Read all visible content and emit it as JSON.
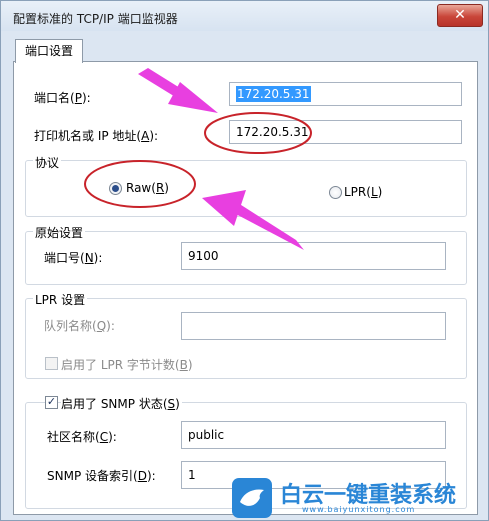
{
  "window": {
    "title": "配置标准的 TCP/IP 端口监视器",
    "close_glyph": "✕"
  },
  "tab": {
    "label": "端口设置"
  },
  "port_name": {
    "label": "端口名(",
    "hotkey": "P",
    "suffix": "):",
    "value": "172.20.5.31"
  },
  "printer_addr": {
    "label": "打印机名或 IP 地址(",
    "hotkey": "A",
    "suffix": "):",
    "value": "172.20.5.31"
  },
  "protocol": {
    "title": "协议",
    "raw": {
      "label": "Raw(",
      "hotkey": "R",
      "suffix": ")",
      "selected": true
    },
    "lpr": {
      "label": "LPR(",
      "hotkey": "L",
      "suffix": ")",
      "selected": false
    }
  },
  "raw_settings": {
    "title": "原始设置",
    "port_number": {
      "label": "端口号(",
      "hotkey": "N",
      "suffix": "):",
      "value": "9100"
    }
  },
  "lpr_settings": {
    "title": "LPR 设置",
    "queue_name": {
      "label": "队列名称(",
      "hotkey": "Q",
      "suffix": "):",
      "value": ""
    },
    "byte_count": {
      "label": "启用了 LPR 字节计数(",
      "hotkey": "B",
      "suffix": ")",
      "checked": false
    }
  },
  "snmp": {
    "enabled": {
      "label": "启用了 SNMP 状态(",
      "hotkey": "S",
      "suffix": ")",
      "checked": true
    },
    "community": {
      "label": "社区名称(",
      "hotkey": "C",
      "suffix": "):",
      "value": "public"
    },
    "device_index": {
      "label": "SNMP 设备索引(",
      "hotkey": "D",
      "suffix": "):",
      "value": "1"
    }
  },
  "watermark": {
    "brand": "白云一键重装系统",
    "url": "www.baiyunxitong.com"
  },
  "colors": {
    "annotation_arrow": "#e83fe0",
    "annotation_circle": "#c8232a",
    "watermark": "#2a86d6"
  }
}
